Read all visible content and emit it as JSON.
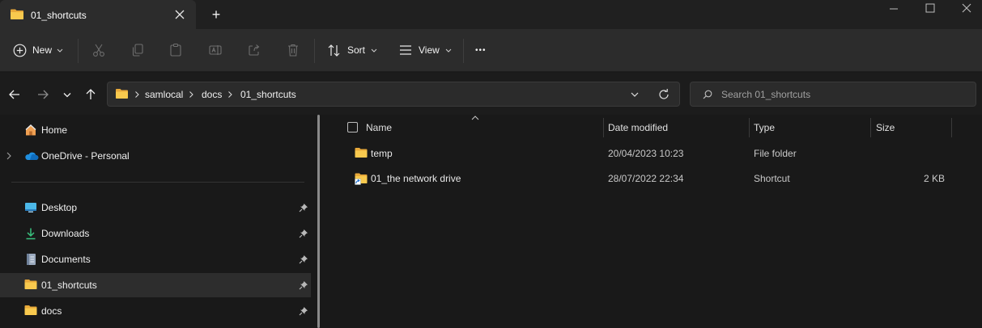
{
  "window": {
    "tab_title": "01_shortcuts",
    "new_tab_symbol": "+",
    "controls": [
      "minimize",
      "maximize",
      "close"
    ]
  },
  "toolbar": {
    "new_label": "New",
    "sort_label": "Sort",
    "view_label": "View",
    "more_symbol": "•••"
  },
  "address": {
    "crumbs": [
      "samlocal",
      "docs",
      "01_shortcuts"
    ],
    "search_placeholder": "Search 01_shortcuts"
  },
  "sidebar": {
    "home": "Home",
    "onedrive": "OneDrive - Personal",
    "quick_access": [
      {
        "label": "Desktop",
        "pinned": true
      },
      {
        "label": "Downloads",
        "pinned": true
      },
      {
        "label": "Documents",
        "pinned": true
      },
      {
        "label": "01_shortcuts",
        "pinned": true,
        "selected": true
      },
      {
        "label": "docs",
        "pinned": true
      }
    ]
  },
  "content": {
    "columns": [
      "Name",
      "Date modified",
      "Type",
      "Size"
    ],
    "files": [
      {
        "name": "temp",
        "date": "20/04/2023 10:23",
        "type": "File folder",
        "size": ""
      },
      {
        "name": "01_the network drive",
        "date": "28/07/2022 22:34",
        "type": "Shortcut",
        "size": "2 KB"
      }
    ]
  },
  "colors": {
    "accent_blue": "#0078d4",
    "folder_yellow": "#f5c24a",
    "background": "#191919"
  }
}
